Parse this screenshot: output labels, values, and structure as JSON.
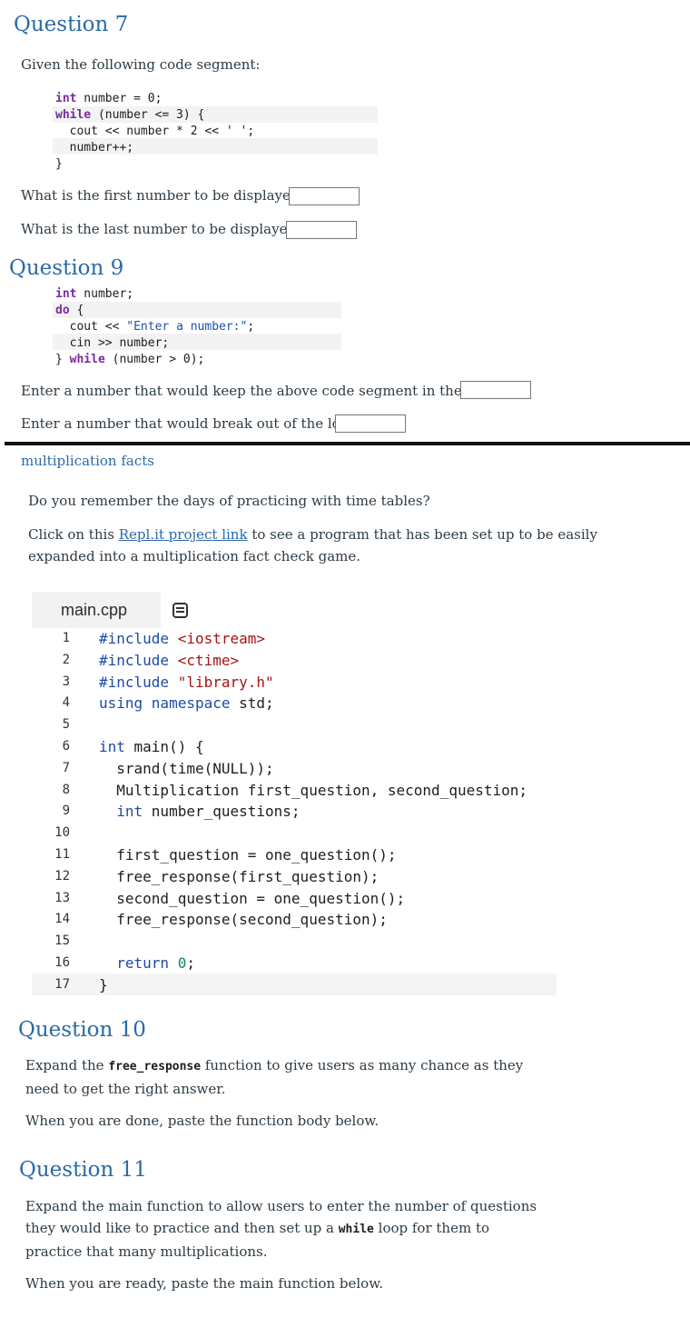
{
  "q7": {
    "title": "Question 7",
    "intro": "Given the following code segment:",
    "code": {
      "l1a": "int",
      "l1b": " number = 0;",
      "l2a": "while",
      "l2b": " (number <= 3) {",
      "l3": "  cout << number * 2 << ' ';",
      "l4": "  number++;",
      "l5": "}"
    },
    "first_label": "What is the first number to be displayed?",
    "last_label": "What is the last number to be displayed?"
  },
  "q9": {
    "title": "Question 9",
    "code": {
      "l1a": "int",
      "l1b": " number;",
      "l2a": "do",
      "l2b": " {",
      "l3a": "  cout << ",
      "l3b": "\"Enter a number:\"",
      "l3c": ";",
      "l4": "  cin >> number;",
      "l5a": "} ",
      "l5b": "while",
      "l5c": " (number > 0);"
    },
    "stay_label": "Enter a number that would keep the above code segment in the loop",
    "break_label": "Enter a number that would break out of the loop"
  },
  "mult": {
    "link": "multiplication facts",
    "p1": "Do you remember the days of practicing with time tables?",
    "p2_pre": "Click on this ",
    "p2_link": "Repl.it project link",
    "p2_post": " to see a program that has been set up to be easily expanded into a multiplication fact check game."
  },
  "repl": {
    "tab": "main.cpp",
    "icon": "file-list-icon",
    "lines": [
      {
        "n": "1",
        "parts": [
          [
            "k",
            "#include "
          ],
          [
            "s",
            "<iostream>"
          ]
        ]
      },
      {
        "n": "2",
        "parts": [
          [
            "k",
            "#include "
          ],
          [
            "s",
            "<ctime>"
          ]
        ]
      },
      {
        "n": "3",
        "parts": [
          [
            "k",
            "#include "
          ],
          [
            "s",
            "\"library.h\""
          ]
        ]
      },
      {
        "n": "4",
        "parts": [
          [
            "k",
            "using namespace "
          ],
          [
            "t",
            "std;"
          ]
        ]
      },
      {
        "n": "5",
        "parts": []
      },
      {
        "n": "6",
        "parts": [
          [
            "k",
            "int "
          ],
          [
            "t",
            "main() {"
          ]
        ]
      },
      {
        "n": "7",
        "parts": [
          [
            "t",
            "  srand(time(NULL));"
          ]
        ]
      },
      {
        "n": "8",
        "parts": [
          [
            "t",
            "  Multiplication first_question, second_question;"
          ]
        ]
      },
      {
        "n": "9",
        "parts": [
          [
            "k",
            "  int "
          ],
          [
            "t",
            "number_questions;"
          ]
        ]
      },
      {
        "n": "10",
        "parts": []
      },
      {
        "n": "11",
        "parts": [
          [
            "t",
            "  first_question = one_question();"
          ]
        ]
      },
      {
        "n": "12",
        "parts": [
          [
            "t",
            "  free_response(first_question);"
          ]
        ]
      },
      {
        "n": "13",
        "parts": [
          [
            "t",
            "  second_question = one_question();"
          ]
        ]
      },
      {
        "n": "14",
        "parts": [
          [
            "t",
            "  free_response(second_question);"
          ]
        ]
      },
      {
        "n": "15",
        "parts": []
      },
      {
        "n": "16",
        "parts": [
          [
            "k",
            "  return "
          ],
          [
            "n",
            "0"
          ],
          [
            "t",
            ";"
          ]
        ]
      },
      {
        "n": "17",
        "parts": [
          [
            "t",
            "}"
          ]
        ]
      }
    ]
  },
  "q10": {
    "title": "Question 10",
    "p1_pre": "Expand the ",
    "p1_code": "free_response",
    "p1_post": " function to give users as many chance as they need to get the right answer.",
    "p2": "When you are done, paste the function body below."
  },
  "q11": {
    "title": "Question 11",
    "p1_pre": "Expand the main function to allow users to enter the number of questions they would like to practice and then set up a ",
    "p1_code": "while",
    "p1_post": " loop for them to practice that many multiplications.",
    "p2": "When you are ready, paste the main function below."
  }
}
